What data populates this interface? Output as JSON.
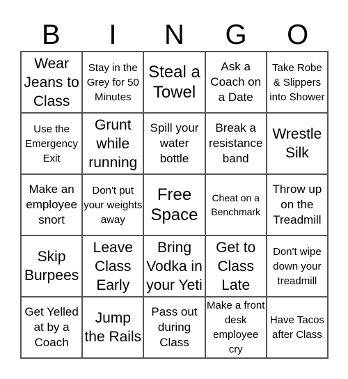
{
  "header": {
    "letters": [
      "B",
      "I",
      "N",
      "G",
      "O"
    ]
  },
  "cells": [
    [
      "Wear Jeans to Class",
      "Stay in the Grey for 50 Minutes",
      "Steal a Towel",
      "Ask a Coach on a Date",
      "Take Robe & Slippers into Shower"
    ],
    [
      "Use the Emergency Exit",
      "Grunt while running",
      "Spill your water bottle",
      "Break a resistance band",
      "Wrestle Silk"
    ],
    [
      "Make an employee snort",
      "Don't put your weights away",
      "Free Space",
      "Cheat on a Benchmark",
      "Throw up on the Treadmill"
    ],
    [
      "Skip Burpees",
      "Leave Class Early",
      "Bring Vodka in your Yeti",
      "Get to Class Late",
      "Don't wipe down your treadmill"
    ],
    [
      "Get Yelled at by a Coach",
      "Jump the Rails",
      "Pass out during Class",
      "Make a front desk employee cry",
      "Have Tacos after Class"
    ]
  ]
}
